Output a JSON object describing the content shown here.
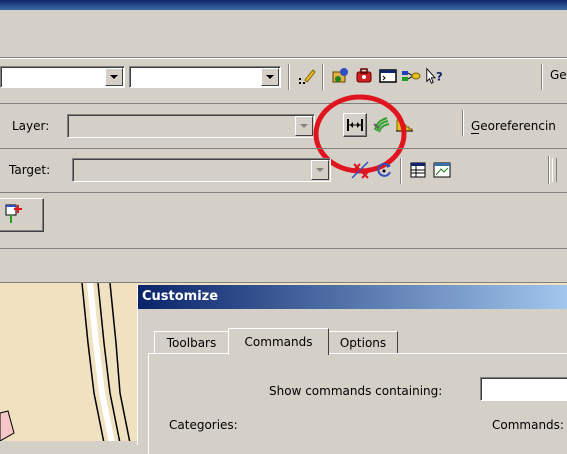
{
  "toolbar1": {
    "combo1_value": "",
    "combo2_value": "",
    "right_text": "Ge"
  },
  "toolbar2": {
    "layer_label": "Layer:",
    "layer_value": "",
    "georef_label": "Georeferencin"
  },
  "toolbar3": {
    "target_label": "Target:",
    "target_value": ""
  },
  "dialog": {
    "title": "Customize",
    "tabs": [
      "Toolbars",
      "Commands",
      "Options"
    ],
    "active_tab": "Commands",
    "show_label": "Show commands containing:",
    "search_value": "",
    "categories_label": "Categories:",
    "commands_label": "Commands:"
  },
  "highlight": {
    "color": "#e0141e",
    "label": "circled-tool-button"
  }
}
